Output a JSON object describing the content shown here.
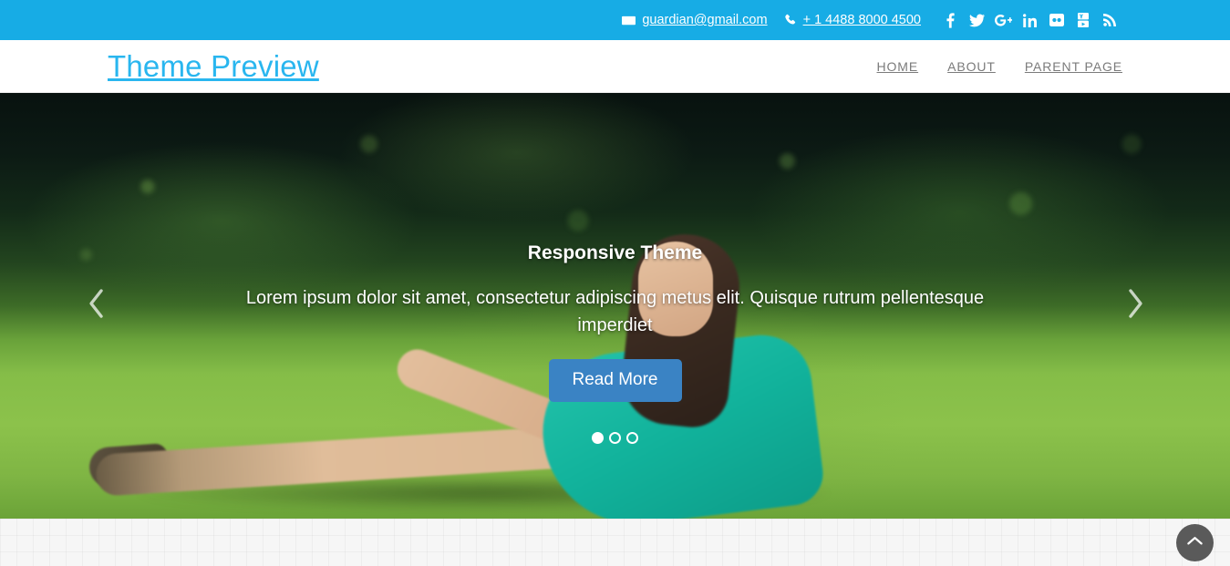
{
  "topbar": {
    "email": "guardian@gmail.com",
    "email_icon": "envelope-icon",
    "phone": "+ 1 4488 8000 4500",
    "phone_icon": "phone-icon",
    "background_color": "#17ace5",
    "social": [
      {
        "name": "facebook-icon",
        "glyph": "f"
      },
      {
        "name": "twitter-icon",
        "glyph": "t"
      },
      {
        "name": "google-plus-icon",
        "glyph": "G+"
      },
      {
        "name": "linkedin-icon",
        "glyph": "in"
      },
      {
        "name": "flickr-icon",
        "glyph": "••"
      },
      {
        "name": "youtube-icon",
        "glyph": "You"
      },
      {
        "name": "rss-icon",
        "glyph": "rss"
      }
    ]
  },
  "header": {
    "site_title": "Theme Preview",
    "title_color": "#29b6ef",
    "nav": [
      {
        "label": "HOME"
      },
      {
        "label": "ABOUT"
      },
      {
        "label": "PARENT PAGE"
      }
    ]
  },
  "hero": {
    "title": "Responsive Theme",
    "description": "Lorem ipsum dolor sit amet, consectetur adipiscing metus elit. Quisque rutrum pellentesque imperdiet",
    "button_label": "Read More",
    "button_color": "#3a83c4",
    "prev_icon": "chevron-left-icon",
    "next_icon": "chevron-right-icon",
    "dots": [
      {
        "active": true
      },
      {
        "active": false
      },
      {
        "active": false
      }
    ]
  },
  "footer_area": {
    "scroll_top_icon": "chevron-up-icon"
  }
}
